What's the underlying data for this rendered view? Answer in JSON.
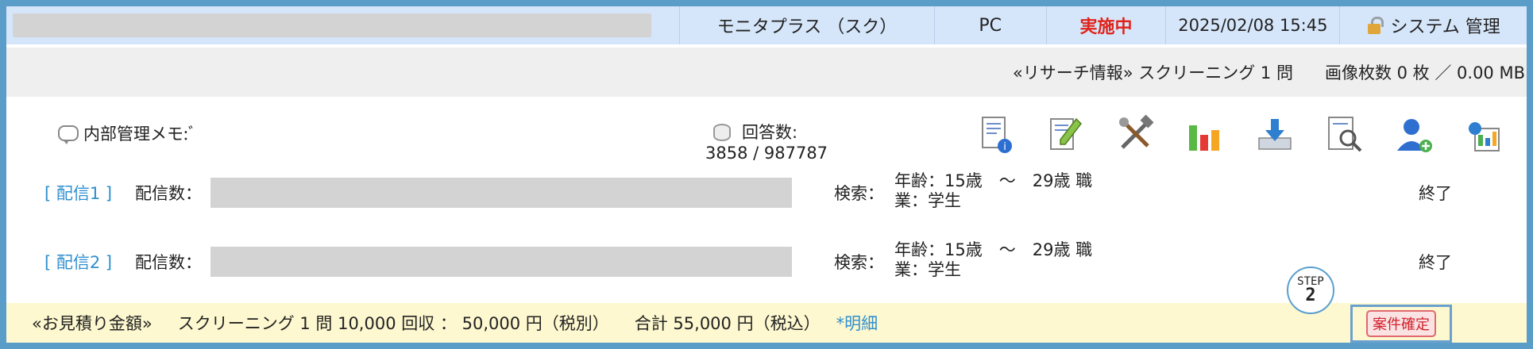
{
  "header": {
    "project_name": "モニタプラス （スク）",
    "device": "PC",
    "status": "実施中",
    "datetime": "2025/02/08 15:45",
    "user": "システム 管理"
  },
  "research_bar": {
    "research_info": "«リサーチ情報» スクリーニング 1 問",
    "image_info": "画像枚数 0 枚 ／ 0.00 MB"
  },
  "memo": {
    "label": "内部管理メモ:ﾞ"
  },
  "answers": {
    "label": "回答数:",
    "value": "3858 / 987787"
  },
  "distributions": [
    {
      "label": "[ 配信1 ]",
      "count_label": "配信数：",
      "search_label": "検索：",
      "criteria_line1": "年齢：15歳　〜　29歳 職",
      "criteria_line2": "業：学生",
      "status": "終了"
    },
    {
      "label": "[ 配信2 ]",
      "count_label": "配信数：",
      "search_label": "検索：",
      "criteria_line1": "年齢：15歳　〜　29歳 職",
      "criteria_line2": "業：学生",
      "status": "終了"
    }
  ],
  "step": {
    "label": "STEP",
    "number": "2"
  },
  "estimate": {
    "title": "«お見積り金額»",
    "screening": "スクリーニング 1 問  10,000 回収 ： 50,000 円（税別）",
    "total": "合計 55,000 円（税込）",
    "detail_link": "*明細"
  },
  "confirm_button": "案件確定",
  "toolbar_icons": [
    "document-info-icon",
    "edit-document-icon",
    "tools-icon",
    "chart-icon",
    "download-icon",
    "preview-icon",
    "add-user-icon",
    "export-icon"
  ]
}
